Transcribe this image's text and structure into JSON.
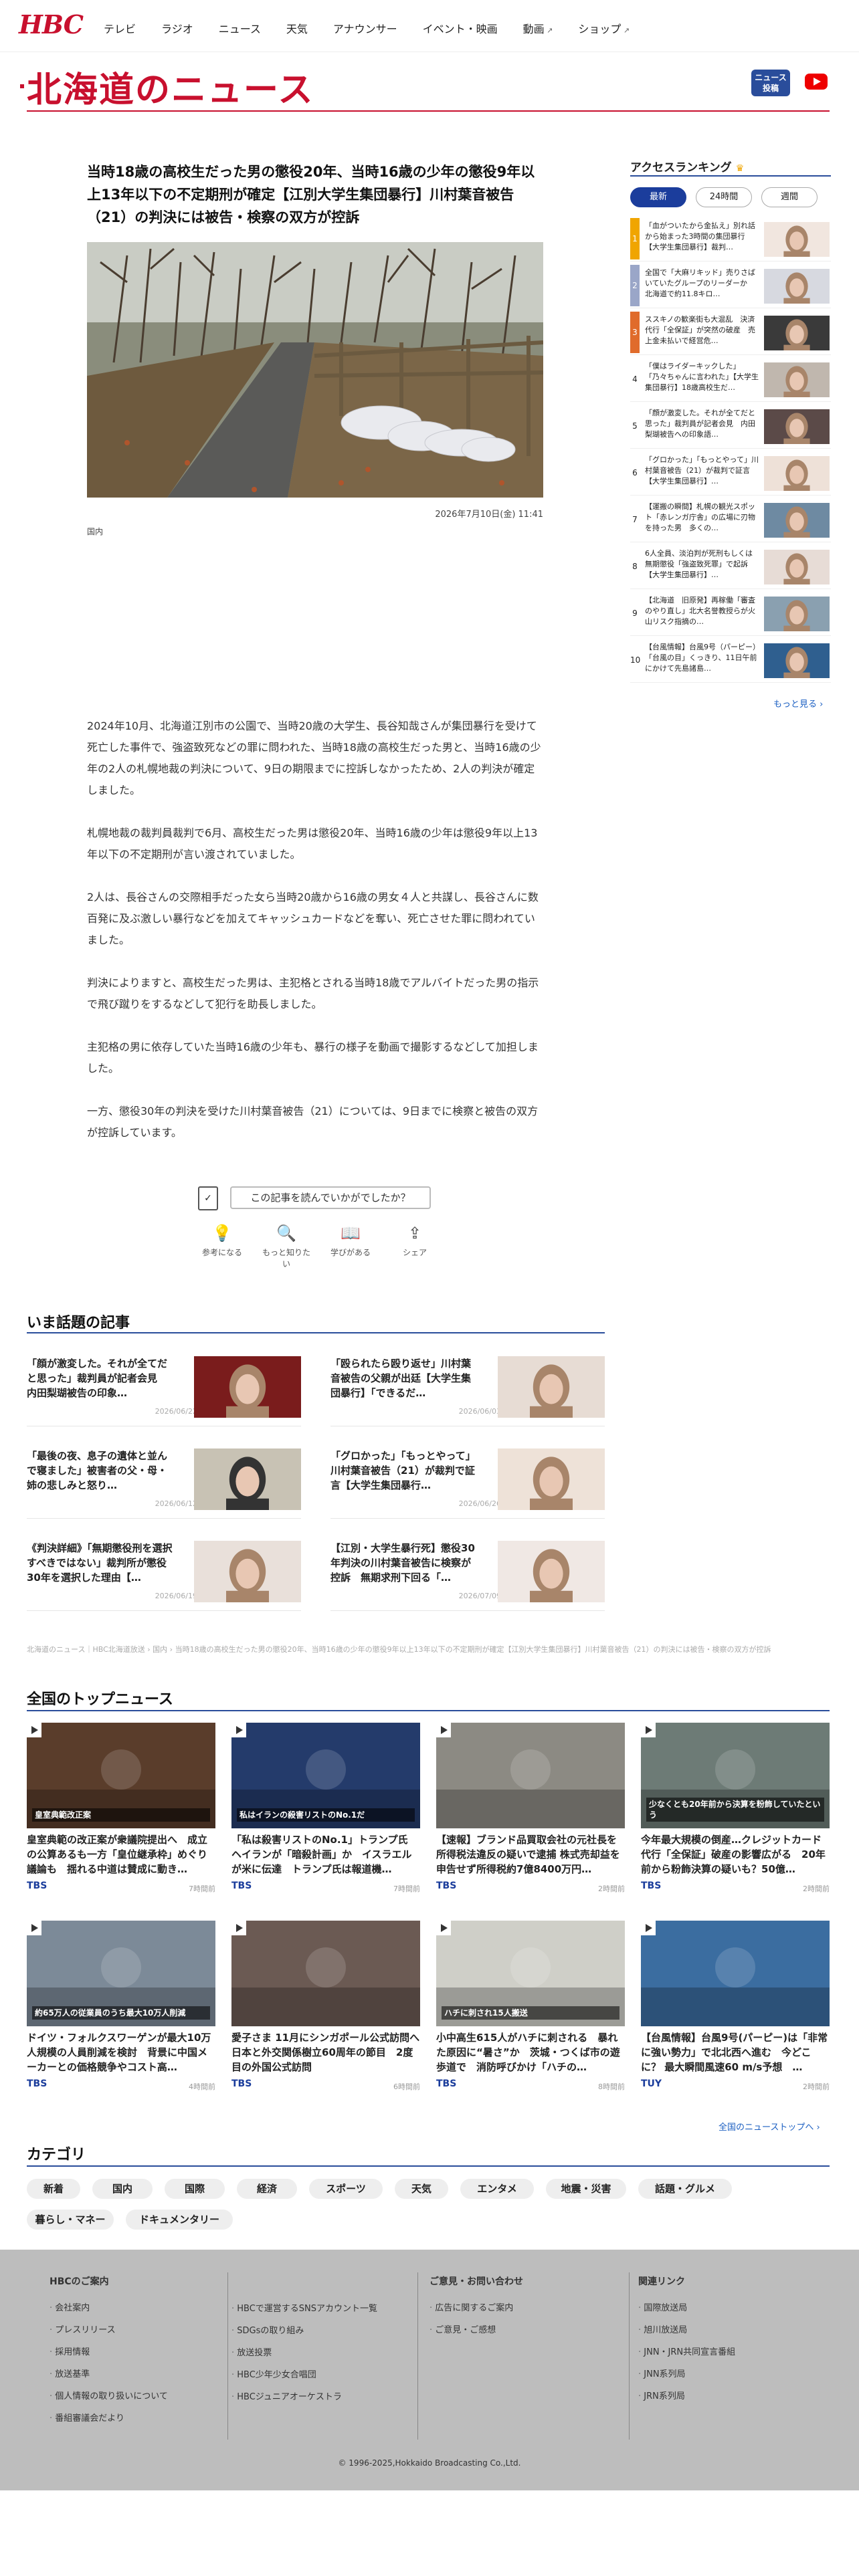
{
  "header": {
    "logo": "HBC",
    "nav": [
      {
        "label": "テレビ",
        "ext": false
      },
      {
        "label": "ラジオ",
        "ext": false
      },
      {
        "label": "ニュース",
        "ext": false
      },
      {
        "label": "天気",
        "ext": false
      },
      {
        "label": "アナウンサー",
        "ext": false
      },
      {
        "label": "イベント・映画",
        "ext": false
      },
      {
        "label": "動画",
        "ext": true
      },
      {
        "label": "ショップ",
        "ext": true
      }
    ]
  },
  "section": {
    "title": "北海道のニュース",
    "news_post_label": "ニュース投稿"
  },
  "article": {
    "title": "当時18歳の高校生だった男の懲役20年、当時16歳の少年の懲役9年以上13年以下の不定期刑が確定【江別大学生集団暴行】川村葉音被告（21）の判決には被告・検察の双方が控訴",
    "date": "2026年7月10日(金) 11:41",
    "category": "国内",
    "paragraphs": [
      "2024年10月、北海道江別市の公園で、当時20歳の大学生、長谷知哉さんが集団暴行を受けて死亡した事件で、強盗致死などの罪に問われた、当時18歳の高校生だった男と、当時16歳の少年の2人の札幌地裁の判決について、9日の期限までに控訴しなかったため、2人の判決が確定しました。",
      "札幌地裁の裁判員裁判で6月、高校生だった男は懲役20年、当時16歳の少年は懲役9年以上13年以下の不定期刑が言い渡されていました。",
      "2人は、長谷さんの交際相手だった女ら当時20歳から16歳の男女４人と共謀し、長谷さんに数百発に及ぶ激しい暴行などを加えてキャッシュカードなどを奪い、死亡させた罪に問われていました。",
      "判決によりますと、高校生だった男は、主犯格とされる当時18歳でアルバイトだった男の指示で飛び蹴りをするなどして犯行を助長しました。",
      "主犯格の男に依存していた当時16歳の少年も、暴行の様子を動画で撮影するなどして加担しました。",
      "一方、懲役30年の判決を受けた川村葉音被告（21）については、9日までに検察と被告の双方が控訴しています。"
    ],
    "survey": "この記事を読んでいかがでしたか？",
    "reactions": [
      "参考になる",
      "もっと知りたい",
      "学びがある",
      "シェア"
    ]
  },
  "ranking": {
    "title": "アクセスランキング",
    "tabs": [
      "最新",
      "24時間",
      "週間"
    ],
    "active_tab": "最新",
    "more": "もっと見る",
    "items": [
      {
        "num": "1",
        "text": "「血がついたから金払え」別れ話から始まった3時間の集団暴行【大学生集団暴行】裁判…",
        "color": "#f0a500"
      },
      {
        "num": "2",
        "text": "全国で「大麻リキッド」売りさばいていたグループのリーダーか　北海道で約11.8キロ…",
        "color": "#9aa6c8"
      },
      {
        "num": "3",
        "text": "ススキノの歓楽街も大混乱　決済代行「全保証」が突然の破産　売上金未払いで経営危…",
        "color": "#e06b2b"
      },
      {
        "num": "4",
        "text": "「僕はライダーキックした」「乃々ちゃんに言われた」【大学生集団暴行】18歳高校生だ…",
        "color": ""
      },
      {
        "num": "5",
        "text": "「顔が激変した。それが全てだと思った」裁判員が記者会見　内田梨瑚被告への印象語…",
        "color": ""
      },
      {
        "num": "6",
        "text": "「グロかった」「もっとやって」川村葉音被告（21）が裁判で証言【大学生集団暴行】…",
        "color": ""
      },
      {
        "num": "7",
        "text": "【運搬の瞬間】札幌の観光スポット「赤レンガ庁舎」の広場に刃物を持った男　多くの…",
        "color": ""
      },
      {
        "num": "8",
        "text": "6人全員、淡泊判が死刑もしくは無期懲役「強盗致死罪」で起訴【大学生集団暴行】…",
        "color": ""
      },
      {
        "num": "9",
        "text": "【北海道　旧原発】再稼働「審査のやり直し」北大名誉教授らが火山リスク指摘の…",
        "color": ""
      },
      {
        "num": "10",
        "text": "【台風情報】台風9号（パーピー）「台風の目」くっきり、11日午前にかけて先島諸島…",
        "color": ""
      }
    ]
  },
  "topics": {
    "title": "いま話題の記事",
    "items": [
      {
        "title": "「顔が激変した。それが全てだと思った」裁判員が記者会見　内田梨瑚被告の印象…",
        "date": "2026/06/22"
      },
      {
        "title": "「殴られたら殴り返せ」川村葉音被告の父親が出廷【大学生集団暴行】「できるだ…",
        "date": "2026/06/03"
      },
      {
        "title": "「最後の夜、息子の遺体と並んで寝ました」被害者の父・母・姉の悲しみと怒り…",
        "date": "2026/06/12"
      },
      {
        "title": "「グロかった」「もっとやって」川村葉音被告（21）が裁判で証言【大学生集団暴行…",
        "date": "2026/06/26"
      },
      {
        "title": "《判決詳細》「無期懲役刑を選択すべきではない」裁判所が懲役30年を選択した理由【…",
        "date": "2026/06/19"
      },
      {
        "title": "【江別・大学生暴行死】懲役30年判決の川村葉音被告に検察が控訴　無期求刑下回る「…",
        "date": "2026/07/09"
      }
    ]
  },
  "breadcrumb": [
    "北海道のニュース｜HBC北海道放送",
    "国内",
    "当時18歳の高校生だった男の懲役20年、当時16歳の少年の懲役9年以上13年以下の不定期刑が確定【江別大学生集団暴行】川村葉音被告（21）の判決には被告・検察の双方が控訴"
  ],
  "national": {
    "title": "全国のトップニュース",
    "more": "全国のニューストップへ",
    "items": [
      {
        "title": "皇室典範の改正案が衆議院提出へ　成立の公算あるも一方「皇位継承枠」めぐり議論も　揺れる中道は賛成に動き…",
        "src": "TBS",
        "time": "7時間前",
        "cap": "皇室典範改正案",
        "bg": "#5a3d2b"
      },
      {
        "title": "「私は殺害リストのNo.1」トランプ氏　ヘイランが「暗殺計画」か　イスラエルが米に伝達　トランプ氏は報道機…",
        "src": "TBS",
        "time": "7時間前",
        "cap": "私はイランの殺害リストのNo.1だ",
        "bg": "#243b6b"
      },
      {
        "title": "【速報】ブランド品買取会社の元社長を所得税法違反の疑いで逮捕 株式売却益を申告せず所得税約7億8400万円…",
        "src": "TBS",
        "time": "2時間前",
        "cap": "",
        "bg": "#8c8a83"
      },
      {
        "title": "今年最大規模の倒産…クレジットカード代行「全保証」破産の影響広がる　20年前から粉飾決算の疑いも？50億…",
        "src": "TBS",
        "time": "2時間前",
        "cap": "少なくとも20年前から決算を粉飾していたという",
        "bg": "#6d7b76"
      },
      {
        "title": "ドイツ・フォルクスワーゲンが最大10万人規模の人員削減を検討　背景に中国メーカーとの価格競争やコスト高…",
        "src": "TBS",
        "time": "4時間前",
        "cap": "約65万人の従業員のうち最大10万人削減",
        "bg": "#7c8a98"
      },
      {
        "title": "愛子さま 11月にシンガポール公式訪問へ　日本と外交関係樹立60周年の節目　2度目の外国公式訪問",
        "src": "TBS",
        "time": "6時間前",
        "cap": "",
        "bg": "#6b5a53"
      },
      {
        "title": "小中高生615人がハチに刺される　暴れた原因に“暑さ”か　茨城・つくば市の遊歩道で　消防呼びかけ「ハチの…",
        "src": "TBS",
        "time": "8時間前",
        "cap": "ハチに刺され15人搬送",
        "bg": "#cfcfc8"
      },
      {
        "title": "【台風情報】台風9号(パーピー)は「非常に強い勢力」で北北西へ進む　今どこに？ 最大瞬間風速60 m/s予想　…",
        "src": "TUY",
        "time": "2時間前",
        "cap": "",
        "bg": "#3b6da0"
      }
    ]
  },
  "categories": {
    "title": "カテゴリ",
    "items": [
      "新着",
      "国内",
      "国際",
      "経済",
      "スポーツ",
      "天気",
      "エンタメ",
      "地震・災害",
      "話題・グルメ",
      "暮らし・マネー",
      "ドキュメンタリー"
    ]
  },
  "footer": {
    "col1_title": "HBCのご案内",
    "col1": [
      "会社案内",
      "プレスリリース",
      "採用情報",
      "放送基準",
      "個人情報の取り扱いについて",
      "番組審議会だより"
    ],
    "col2": [
      "HBCで運営するSNSアカウント一覧",
      "SDGsの取り組み",
      "放送投票",
      "HBC少年少女合唱団",
      "HBCジュニアオーケストラ"
    ],
    "col3_title": "ご意見・お問い合わせ",
    "col3": [
      "広告に関するご案内",
      "ご意見・ご感想"
    ],
    "col4_title": "関連リンク",
    "col4": [
      "国際放送局",
      "旭川放送局",
      "JNN・JRN共同宣言番組",
      "JNN系列局",
      "JRN系列局"
    ],
    "copyright": "© 1996-2025,Hokkaido Broadcasting Co.,Ltd."
  }
}
